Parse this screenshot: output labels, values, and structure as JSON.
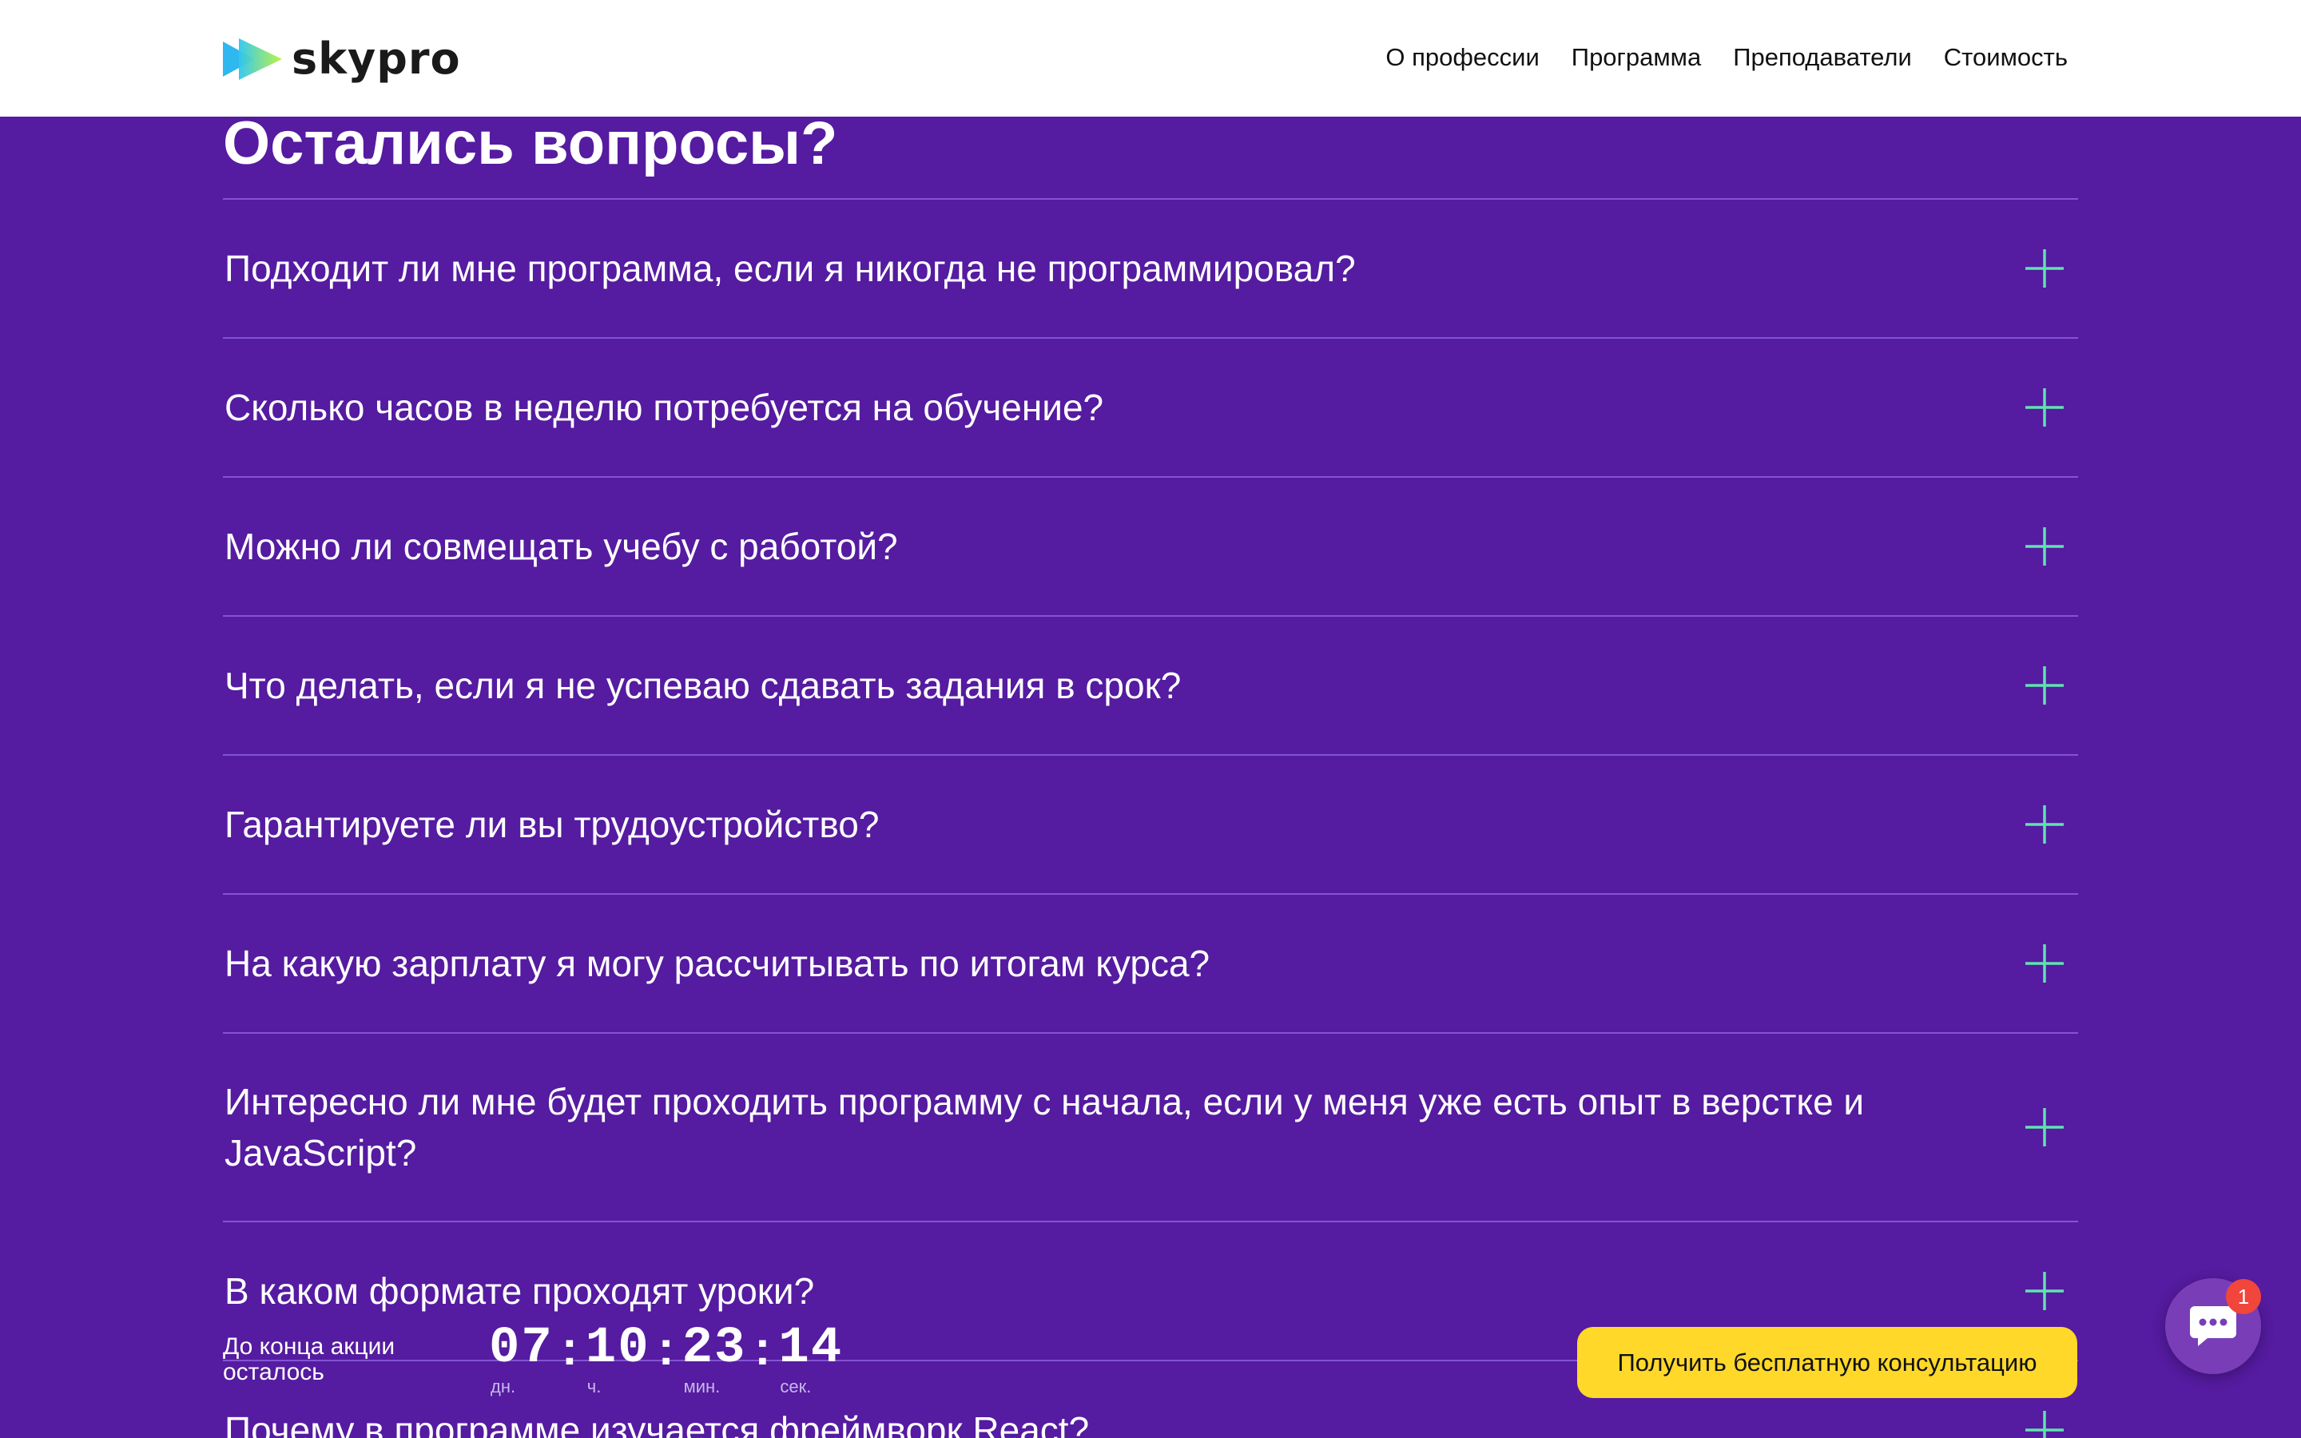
{
  "header": {
    "logo_text": "skypro",
    "nav": [
      "О профессии",
      "Программа",
      "Преподаватели",
      "Стоимость"
    ]
  },
  "faq": {
    "title": "Остались вопросы?",
    "items": [
      "Подходит ли мне программа, если я никогда не программировал?",
      "Сколько часов в неделю потребуется на обучение?",
      "Можно ли совмещать учебу с работой?",
      "Что делать, если я не успеваю сдавать задания в срок?",
      "Гарантируете ли вы трудоустройство?",
      "На какую зарплату я могу рассчитывать по итогам курса?",
      "Интересно ли мне будет проходить программу с начала, если у меня уже есть опыт в верстке и JavaScript?",
      "В каком формате проходят уроки?",
      "Почему в программе изучается фреймворк React?"
    ],
    "expand_icon": "plus-icon"
  },
  "promo": {
    "label": "До конца акции осталось",
    "days": "07",
    "days_unit": "дн.",
    "hours": "10",
    "hours_unit": "ч.",
    "minutes": "23",
    "minutes_unit": "мин.",
    "seconds": "14",
    "seconds_unit": "сек.",
    "separator": ":"
  },
  "cta": {
    "label": "Получить бесплатную консультацию"
  },
  "chat": {
    "icon": "chat-icon",
    "badge_count": "1"
  },
  "colors": {
    "background": "#551ba0",
    "divider": "#8553d6",
    "plus": "#5fe3b0",
    "cta": "#ffd82a",
    "badge": "#f0463c"
  }
}
